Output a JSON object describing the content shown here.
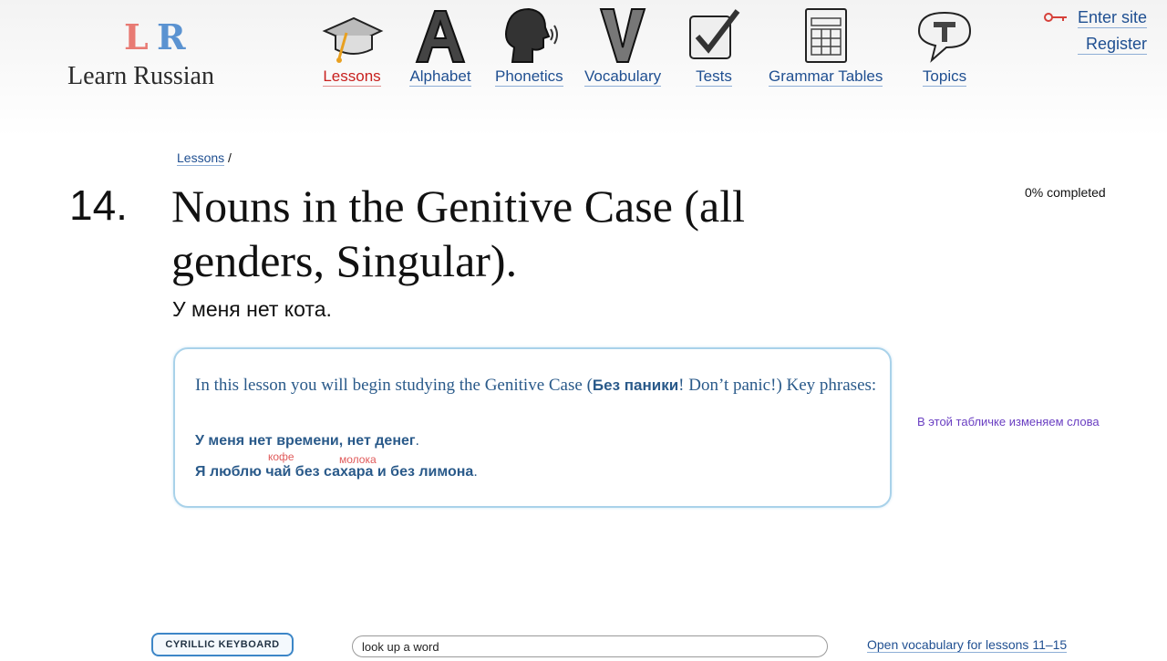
{
  "site": {
    "logo_mark": "LR",
    "logo_text": "Learn Russian"
  },
  "nav": {
    "lessons": "Lessons",
    "alphabet": "Alphabet",
    "phonetics": "Phonetics",
    "vocabulary": "Vocabulary",
    "tests": "Tests",
    "grammar_tables": "Grammar Tables",
    "topics": "Topics",
    "active": "Lessons"
  },
  "auth": {
    "enter_site": "Enter site",
    "register": "Register"
  },
  "breadcrumb": {
    "lessons": "Lessons",
    "separator": "/"
  },
  "lesson": {
    "number": "14.",
    "title": "Nouns in the Genitive Case (all genders, Singular).",
    "subtitle": "У меня нет кота.",
    "progress": "0% completed"
  },
  "intro": {
    "text_before": "In this lesson you will begin studying the Genitive Case (",
    "bold": "Без паники",
    "text_after": "! Don’t panic!) Key phrases:",
    "phrase1": "У меня нет времени, нет денег",
    "phrase1_end": ".",
    "phrase2_a": "Я люблю ",
    "phrase2_chai": "чай",
    "phrase2_b": " без ",
    "phrase2_sahara": "сахара",
    "phrase2_c": " и без лимона",
    "phrase2_end": ".",
    "hint_chai": "кофе",
    "hint_sahara": "молока"
  },
  "side_note": "В этой табличке изменяем слова",
  "footer": {
    "keyboard_button": "CYRILLIC KEYBOARD",
    "search_value": "look up a word",
    "vocab_link": "Open vocabulary for lessons 11–15"
  },
  "colors": {
    "link": "#1f4f91",
    "active": "#c8201e",
    "box_border": "#a9d2ea",
    "hint": "#e05a5a",
    "note": "#6a3fc2"
  }
}
